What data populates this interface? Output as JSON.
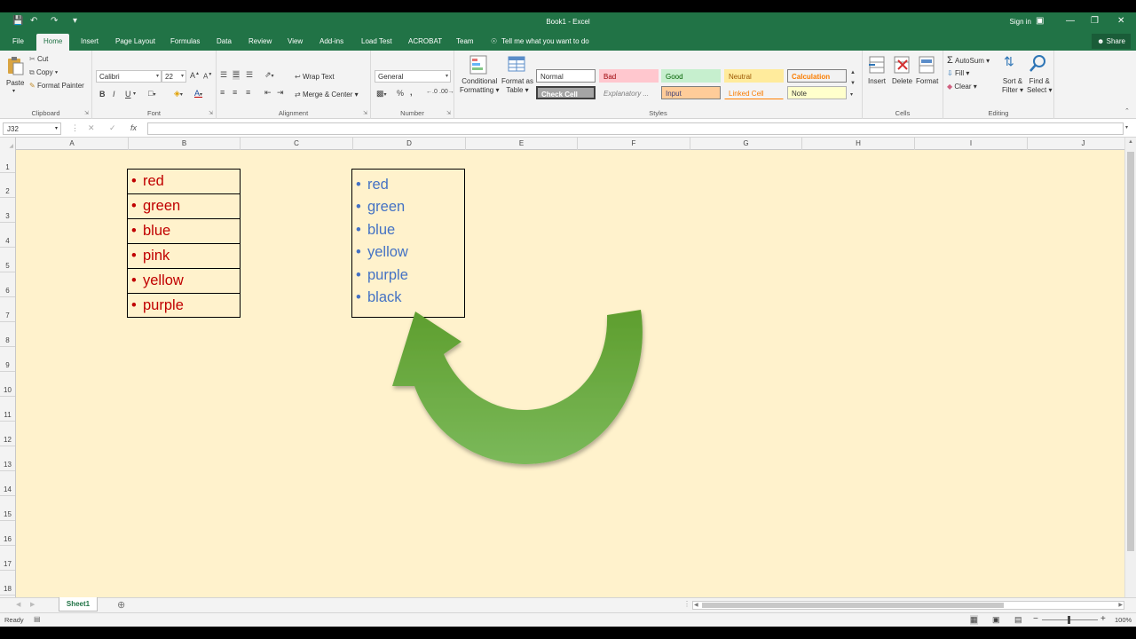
{
  "titlebar": {
    "title": "Book1 - Excel",
    "sign_in": "Sign in"
  },
  "tabs": [
    "File",
    "Home",
    "Insert",
    "Page Layout",
    "Formulas",
    "Data",
    "Review",
    "View",
    "Add-ins",
    "Load Test",
    "ACROBAT",
    "Team"
  ],
  "active_tab": "Home",
  "tell_me": "Tell me what you want to do",
  "share": "Share",
  "ribbon": {
    "clipboard": {
      "paste": "Paste",
      "cut": "Cut",
      "copy": "Copy",
      "format_painter": "Format Painter",
      "label": "Clipboard"
    },
    "font": {
      "name": "Calibri",
      "size": "22",
      "bold": "B",
      "italic": "I",
      "underline": "U",
      "label": "Font"
    },
    "alignment": {
      "wrap_text": "Wrap Text",
      "merge_center": "Merge & Center",
      "label": "Alignment"
    },
    "number": {
      "format": "General",
      "percent": "%",
      "comma": ",",
      "label": "Number"
    },
    "styles": {
      "conditional_formatting": [
        "Conditional",
        "Formatting"
      ],
      "format_as_table": [
        "Format as",
        "Table"
      ],
      "cells": [
        "Normal",
        "Bad",
        "Good",
        "Neutral",
        "Calculation",
        "Check Cell",
        "Explanatory ...",
        "Input",
        "Linked Cell",
        "Note"
      ],
      "label": "Styles"
    },
    "cells": {
      "insert": "Insert",
      "delete": "Delete",
      "format": "Format",
      "label": "Cells"
    },
    "editing": {
      "autosum": "AutoSum",
      "fill": "Fill",
      "clear": "Clear",
      "sort_filter": [
        "Sort &",
        "Filter"
      ],
      "find_select": [
        "Find &",
        "Select"
      ],
      "label": "Editing"
    }
  },
  "formula_bar": {
    "name_box": "J32",
    "fx": "fx",
    "value": ""
  },
  "columns": [
    "A",
    "B",
    "C",
    "D",
    "E",
    "F",
    "G",
    "H",
    "I",
    "J"
  ],
  "rows": [
    "1",
    "2",
    "3",
    "4",
    "5",
    "6",
    "7",
    "8",
    "9",
    "10",
    "11",
    "12",
    "13",
    "14",
    "15",
    "16",
    "17",
    "18"
  ],
  "list_one": {
    "bullet": "•",
    "items": [
      "red",
      "green",
      "blue",
      "pink",
      "yellow",
      "purple"
    ],
    "color": "#c00000"
  },
  "list_two": {
    "bullet": "•",
    "items": [
      "red",
      "green",
      "blue",
      "yellow",
      "purple",
      "black"
    ],
    "color": "#4472c4"
  },
  "sheet_tab": "Sheet1",
  "status": {
    "ready": "Ready",
    "zoom": "100%"
  },
  "colors": {
    "excel_green": "#217346",
    "sheet_fill": "#fff2cc",
    "arrow_green": "#70ad47"
  }
}
